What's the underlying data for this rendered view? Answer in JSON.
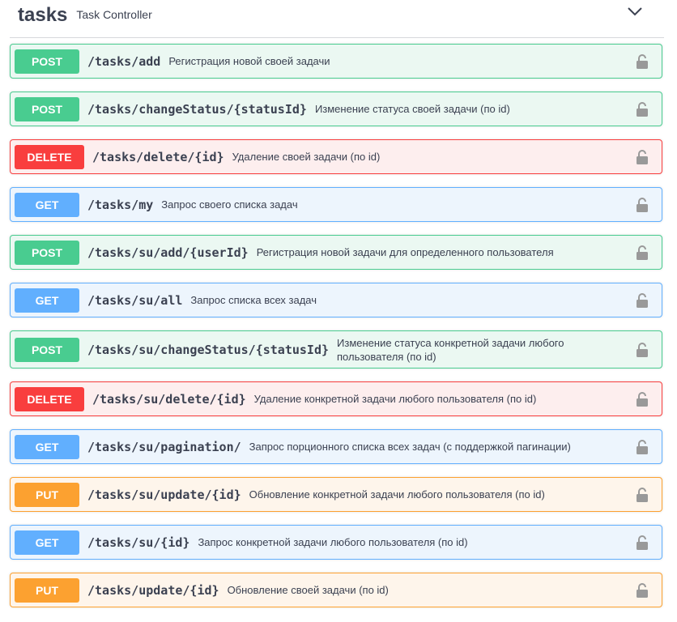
{
  "tag": {
    "name": "tasks",
    "description": "Task Controller",
    "toggle_icon": "chevron-down-icon"
  },
  "colors": {
    "post": "#49cc90",
    "get": "#61affe",
    "delete": "#f93e3e",
    "put": "#fca130"
  },
  "operations": [
    {
      "method": "POST",
      "path": "/tasks/add",
      "summary": "Регистрация новой своей задачи"
    },
    {
      "method": "POST",
      "path": "/tasks/changeStatus/{statusId}",
      "summary": "Изменение статуса своей задачи (по id)"
    },
    {
      "method": "DELETE",
      "path": "/tasks/delete/{id}",
      "summary": "Удаление своей задачи (по id)"
    },
    {
      "method": "GET",
      "path": "/tasks/my",
      "summary": "Запрос своего списка задач"
    },
    {
      "method": "POST",
      "path": "/tasks/su/add/{userId}",
      "summary": "Регистрация новой задачи для определенного пользователя"
    },
    {
      "method": "GET",
      "path": "/tasks/su/all",
      "summary": "Запрос списка всех задач"
    },
    {
      "method": "POST",
      "path": "/tasks/su/changeStatus/{statusId}",
      "summary": "Изменение статуса конкретной задачи любого пользователя (по id)"
    },
    {
      "method": "DELETE",
      "path": "/tasks/su/delete/{id}",
      "summary": "Удаление конкретной задачи любого пользователя (по id)"
    },
    {
      "method": "GET",
      "path": "/tasks/su/pagination/",
      "summary": "Запрос порционного списка всех задач (с поддержкой пагинации)"
    },
    {
      "method": "PUT",
      "path": "/tasks/su/update/{id}",
      "summary": "Обновление конкретной задачи любого пользователя (по id)"
    },
    {
      "method": "GET",
      "path": "/tasks/su/{id}",
      "summary": "Запрос конкретной задачи любого пользователя (по id)"
    },
    {
      "method": "PUT",
      "path": "/tasks/update/{id}",
      "summary": "Обновление своей задачи (по id)"
    }
  ]
}
